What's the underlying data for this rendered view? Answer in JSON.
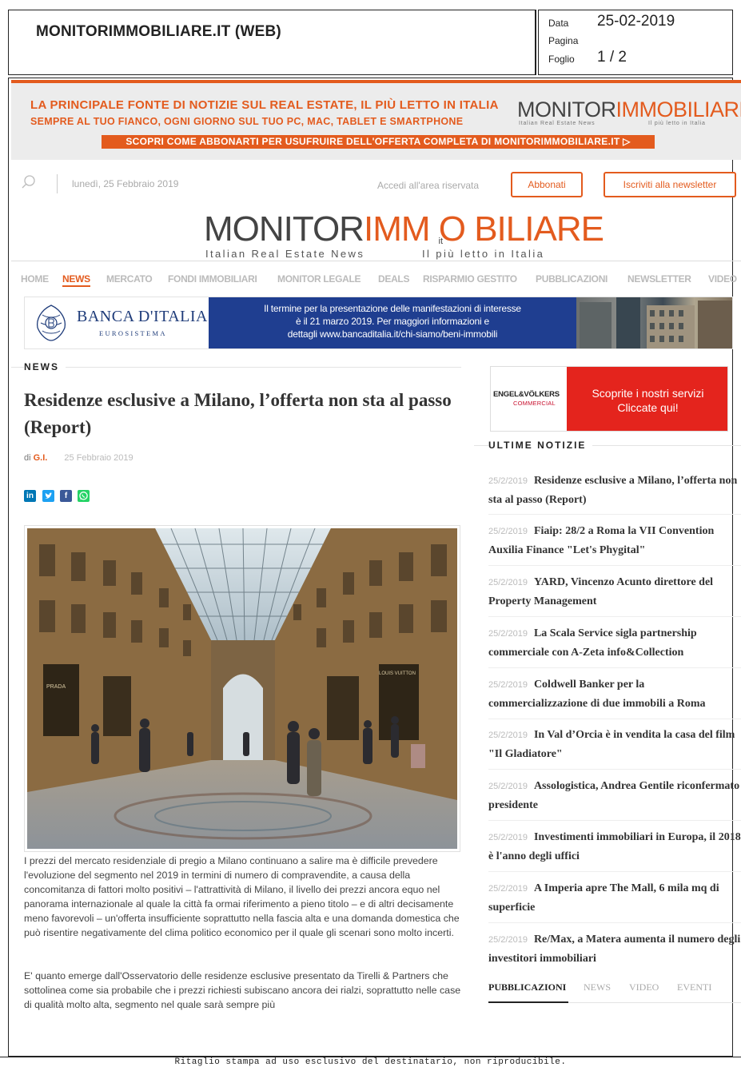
{
  "clipping": {
    "publication": "MONITORIMMOBILIARE.IT (WEB)",
    "data_label": "Data",
    "data_value": "25-02-2019",
    "pagina_label": "Pagina",
    "pagina_value": "",
    "foglio_label": "Foglio",
    "foglio_value": "1 / 2",
    "footer": "Ritaglio stampa ad uso esclusivo del destinatario, non riproducibile."
  },
  "banner": {
    "line1": "LA PRINCIPALE FONTE DI NOTIZIE SUL REAL ESTATE, IL PIÙ LETTO IN ITALIA",
    "line2": "SEMPRE AL TUO FIANCO, OGNI GIORNO SUL TUO PC, MAC, TABLET E SMARTPHONE",
    "logo_a": "MONITOR",
    "logo_b": "IMM",
    "logo_c": "O",
    "logo_d": "BILIARE",
    "sub1": "Italian Real Estate News",
    "sub2": "Il più letto in Italia",
    "cta": "SCOPRI COME ABBONARTI PER USUFRUIRE DELL'OFFERTA COMPLETA DI MONITORIMMOBILIARE.IT"
  },
  "header": {
    "date": "lunedì, 25 Febbraio 2019",
    "login": "Accedi all'area riservata",
    "subscribe": "Abbonati",
    "newsletter": "Iscriviti alla newsletter",
    "logo_a": "MONITOR",
    "logo_b": "IMM",
    "logo_c": "O",
    "logo_d": "BILIARE",
    "logo_it": "it",
    "tagline_left": "Italian Real Estate News",
    "tagline_right": "Il più letto in Italia"
  },
  "nav": [
    "HOME",
    "NEWS",
    "MERCATO",
    "FONDI IMMOBILIARI",
    "MONITOR LEGALE",
    "DEALS",
    "RISPARMIO GESTITO",
    "PUBBLICAZIONI",
    "NEWSLETTER",
    "VIDEO"
  ],
  "ad": {
    "bank_name": "BANCA D'ITALIA",
    "bank_sub": "EUROSISTEMA",
    "text1": "Il termine per la presentazione delle manifestazioni di interesse",
    "text2": "è il 21 marzo 2019. Per maggiori informazioni e",
    "text3": "dettagli www.bancaditalia.it/chi-siamo/beni-immobili"
  },
  "article": {
    "section": "NEWS",
    "title": "Residenze esclusive a Milano, l’offerta non sta al passo (Report)",
    "by": "di",
    "author": "G.I.",
    "date": "25 Febbraio 2019",
    "p1": "I prezzi del mercato residenziale di pregio a Milano continuano a salire ma è difficile prevedere l'evoluzione del segmento nel 2019 in termini di numero di compravendite, a causa della concomitanza di fattori molto positivi – l'attrattività di Milano, il livello dei prezzi ancora equo nel panorama internazionale al quale la città fa ormai riferimento a pieno titolo – e di altri decisamente meno favorevoli – un'offerta insufficiente soprattutto nella fascia alta e una domanda domestica che può risentire negativamente del clima politico economico per il quale gli scenari sono molto incerti.",
    "p2": "E' quanto emerge dall'Osservatorio delle residenze esclusive presentato da Tirelli & Partners che sottolinea come sia probabile che i prezzi richiesti subiscano ancora dei rialzi, soprattutto nelle case di qualità molto alta, segmento nel quale sarà sempre più"
  },
  "photo_signs": {
    "left": "PRADA",
    "right": "LOUIS VUITTON"
  },
  "sidebar": {
    "ad_logo": "ENGEL&VÖLKERS",
    "ad_logo_sub": "COMMERCIAL",
    "ad_text1": "Scoprite i nostri servizi",
    "ad_text2": "Cliccate qui!",
    "section": "ULTIME NOTIZIE",
    "news": [
      {
        "date": "25/2/2019",
        "title": "Residenze esclusive a Milano, l’offerta non sta al passo (Report)"
      },
      {
        "date": "25/2/2019",
        "title": "Fiaip: 28/2 a Roma la VII Convention Auxilia Finance \"Let's Phygital\""
      },
      {
        "date": "25/2/2019",
        "title": "YARD, Vincenzo Acunto direttore del Property Management"
      },
      {
        "date": "25/2/2019",
        "title": "La Scala Service sigla partnership commerciale con A-Zeta info&Collection"
      },
      {
        "date": "25/2/2019",
        "title": "Coldwell Banker per la commercializzazione di due immobili a Roma"
      },
      {
        "date": "25/2/2019",
        "title": "In Val d’Orcia è in vendita la casa del film \"Il Gladiatore\""
      },
      {
        "date": "25/2/2019",
        "title": "Assologistica, Andrea Gentile riconfermato presidente"
      },
      {
        "date": "25/2/2019",
        "title": "Investimenti immobiliari in Europa, il 2018 è l'anno degli uffici"
      },
      {
        "date": "25/2/2019",
        "title": "A Imperia apre The Mall, 6 mila mq di superficie"
      },
      {
        "date": "25/2/2019",
        "title": "Re/Max, a Matera aumenta il numero degli investitori immobiliari"
      }
    ],
    "tabs": [
      "PUBBLICAZIONI",
      "NEWS",
      "VIDEO",
      "EVENTI"
    ]
  },
  "colors": {
    "accent": "#e35b1e",
    "bank_blue": "#1f3e90",
    "ev_red": "#e4241d"
  }
}
